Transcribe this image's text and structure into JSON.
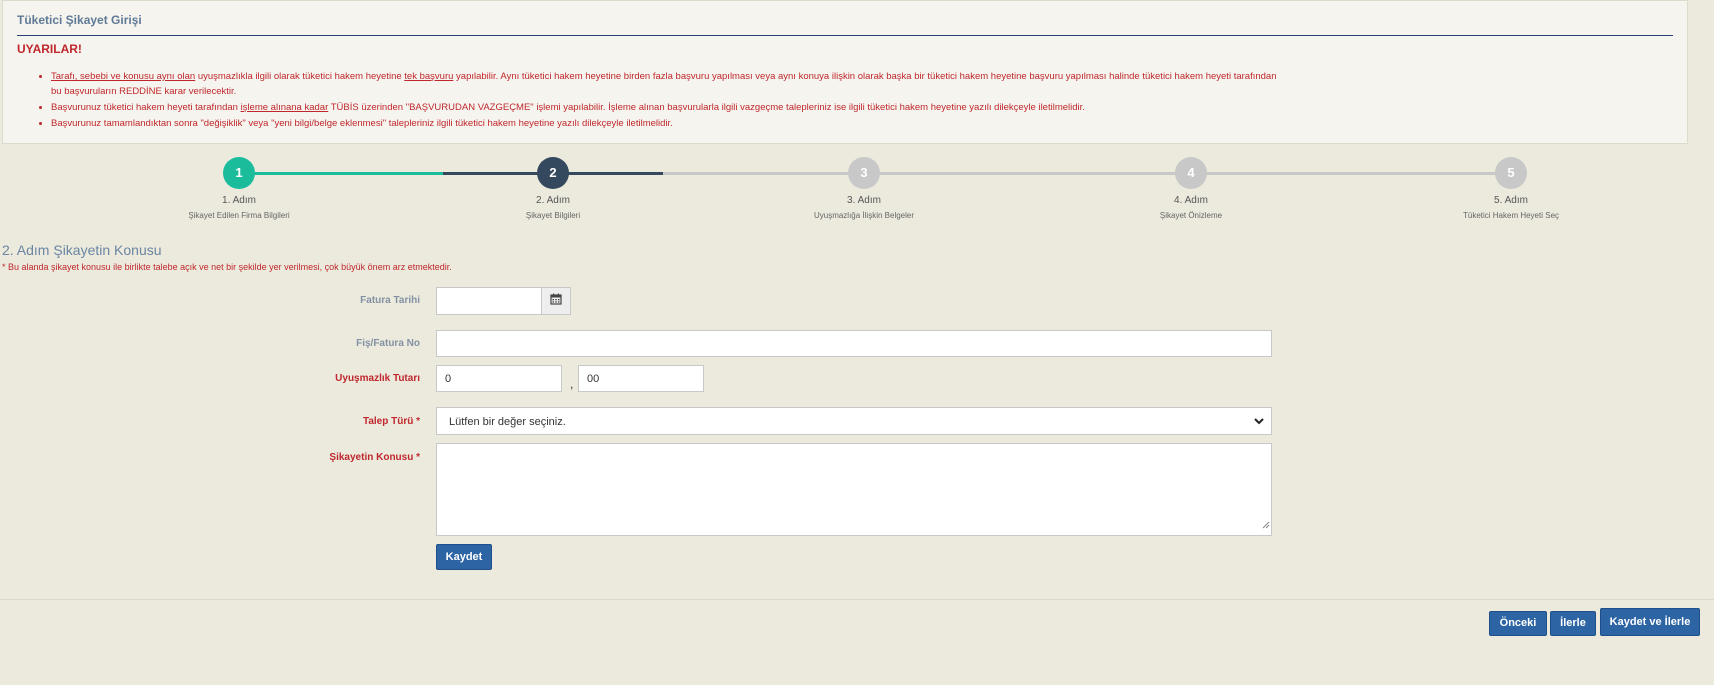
{
  "panel": {
    "title": "Tüketici Şikayet Girişi",
    "warning_heading": "UYARILAR!",
    "warnings": [
      {
        "part1": "Tarafı, sebebi ve konusu aynı olan",
        "part2": " uyuşmazlıkla ilgili olarak tüketici hakem heyetine ",
        "part3": "tek başvuru",
        "part4": " yapılabilir. Aynı tüketici hakem heyetine birden fazla başvuru yapılması veya aynı konuya ilişkin olarak başka bir tüketici hakem heyetine başvuru yapılması halinde tüketici hakem heyeti tarafından",
        "part5": "bu başvuruların REDDİNE karar verilecektir."
      },
      {
        "part1": "Başvurunuz tüketici hakem heyeti tarafından ",
        "part2": "işleme alınana kadar",
        "part3": " TÜBİS üzerinden \"BAŞVURUDAN VAZGEÇME\" işlemi yapılabilir. İşleme alınan başvurularla ilgili vazgeçme talepleriniz ise ilgili tüketici hakem heyetine yazılı dilekçeyle iletilmelidir."
      },
      {
        "part1": "Başvurunuz tamamlandıktan sonra \"değişiklik\" veya \"yeni bilgi/belge eklenmesi\" talepleriniz ilgili tüketici hakem heyetine yazılı dilekçeyle iletilmelidir."
      }
    ]
  },
  "steps": [
    {
      "number": "1",
      "title": "1. Adım",
      "subtitle": "Şikayet Edilen Firma Bilgileri",
      "state": "done"
    },
    {
      "number": "2",
      "title": "2. Adım",
      "subtitle": "Şikayet Bilgileri",
      "state": "active"
    },
    {
      "number": "3",
      "title": "3. Adım",
      "subtitle": "Uyuşmazlığa İlişkin Belgeler",
      "state": "pending"
    },
    {
      "number": "4",
      "title": "4. Adım",
      "subtitle": "Şikayet Önizleme",
      "state": "pending"
    },
    {
      "number": "5",
      "title": "5. Adım",
      "subtitle": "Tüketici Hakem Heyeti Seç",
      "state": "pending"
    }
  ],
  "colors": {
    "done": "#1abc9c",
    "active": "#34495e",
    "pending": "#c8c8c8",
    "warning_red": "#c0272d",
    "button_blue": "#2d64a3"
  },
  "form": {
    "section_title": "2. Adım Şikayetin Konusu",
    "section_note": "* Bu alanda şikayet konusu ile birlikte talebe açık ve net bir şekilde yer verilmesi, çok büyük önem arz etmektedir.",
    "invoice_date": {
      "label": "Fatura Tarihi",
      "value": "",
      "icon": "calendar-icon"
    },
    "receipt_no": {
      "label": "Fiş/Fatura No",
      "value": ""
    },
    "amount": {
      "label": "Uyuşmazlık Tutarı",
      "whole": "0",
      "separator": ",",
      "fraction": "00"
    },
    "request_type": {
      "label": "Talep Türü *",
      "selected": "Lütfen bir değer seçiniz.",
      "icon": "chevron-down-icon"
    },
    "complaint_subject": {
      "label": "Şikayetin Konusu *",
      "value": ""
    },
    "save_label": "Kaydet"
  },
  "footer": {
    "prev_label": "Önceki",
    "next_label": "İlerle",
    "save_next_label": "Kaydet ve İlerle"
  }
}
